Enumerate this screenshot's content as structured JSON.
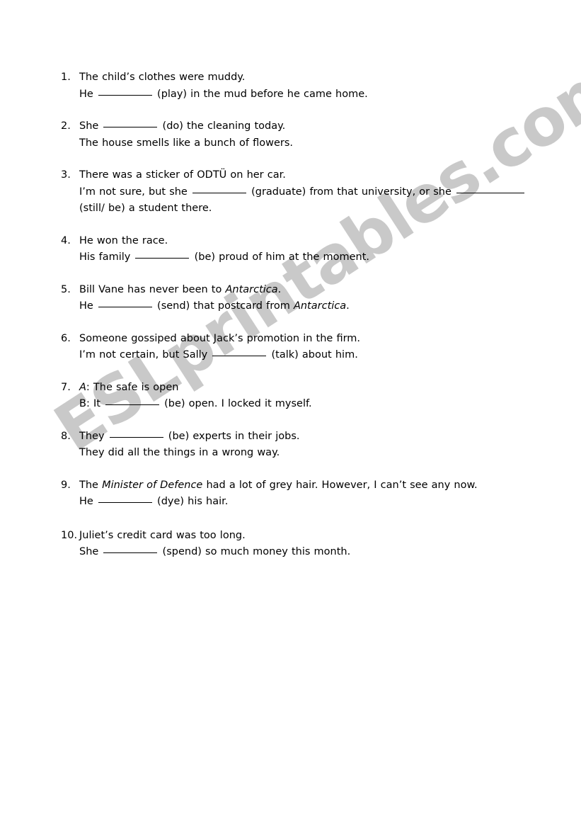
{
  "watermark": {
    "text": "ESLprintables.com",
    "color": "#c9c9c9"
  },
  "worksheet": {
    "items": [
      {
        "number": "1.",
        "lines": [
          {
            "segments": [
              {
                "text": "The child’s clothes were muddy."
              }
            ]
          },
          {
            "segments": [
              {
                "text": "He "
              },
              {
                "blank": "std"
              },
              {
                "text": " (play) in the mud before he came home."
              }
            ]
          }
        ]
      },
      {
        "number": "2.",
        "lines": [
          {
            "segments": [
              {
                "text": "She "
              },
              {
                "blank": "std"
              },
              {
                "text": " (do) the cleaning today."
              }
            ]
          },
          {
            "segments": [
              {
                "text": "The house smells like a bunch of flowers."
              }
            ]
          }
        ]
      },
      {
        "number": "3.",
        "lines": [
          {
            "segments": [
              {
                "text": "There was a sticker of ODTÜ on her car."
              }
            ]
          },
          {
            "segments": [
              {
                "text": "I’m not sure, but she "
              },
              {
                "blank": "std"
              },
              {
                "text": " (graduate) from that university, or she "
              },
              {
                "blank": "long"
              }
            ]
          },
          {
            "segments": [
              {
                "text": "(still/ be) a student there."
              }
            ]
          }
        ]
      },
      {
        "number": "4.",
        "lines": [
          {
            "segments": [
              {
                "text": "He won the race."
              }
            ]
          },
          {
            "segments": [
              {
                "text": "His family "
              },
              {
                "blank": "std"
              },
              {
                "text": " (be) proud of him at the moment."
              }
            ]
          }
        ]
      },
      {
        "number": "5.",
        "lines": [
          {
            "segments": [
              {
                "text": "Bill Vane has never been to "
              },
              {
                "text": "Antarctica",
                "italic": true
              },
              {
                "text": "."
              }
            ]
          },
          {
            "segments": [
              {
                "text": "He "
              },
              {
                "blank": "std"
              },
              {
                "text": " (send) that postcard from "
              },
              {
                "text": "Antarctica",
                "italic": true
              },
              {
                "text": "."
              }
            ]
          }
        ]
      },
      {
        "number": "6.",
        "lines": [
          {
            "segments": [
              {
                "text": "Someone gossiped about Jack’s promotion in the firm."
              }
            ]
          },
          {
            "segments": [
              {
                "text": "I’m not certain, but Sally "
              },
              {
                "blank": "std"
              },
              {
                "text": " (talk) about him."
              }
            ]
          }
        ]
      },
      {
        "number": "7.",
        "lines": [
          {
            "segments": [
              {
                "text": "A",
                "italic": true
              },
              {
                "text": ": The safe is open"
              }
            ]
          },
          {
            "segments": [
              {
                "text": "B: It "
              },
              {
                "blank": "std"
              },
              {
                "text": " (be) open. I locked it myself."
              }
            ]
          }
        ]
      },
      {
        "number": "8.",
        "lines": [
          {
            "segments": [
              {
                "text": "They "
              },
              {
                "blank": "std"
              },
              {
                "text": " (be) experts in their jobs."
              }
            ]
          },
          {
            "segments": [
              {
                "text": "They did all the things in a wrong way."
              }
            ]
          }
        ]
      },
      {
        "number": "9.",
        "lines": [
          {
            "segments": [
              {
                "text": "The "
              },
              {
                "text": "Minister of Defence",
                "italic": true
              },
              {
                "text": " had a lot of grey hair. However, I can’t see any now."
              }
            ]
          },
          {
            "segments": [
              {
                "text": "He "
              },
              {
                "blank": "std"
              },
              {
                "text": " (dye) his hair."
              }
            ]
          }
        ]
      },
      {
        "number": "10.",
        "extra_gap": true,
        "lines": [
          {
            "segments": [
              {
                "text": "Juliet’s credit card was too long."
              }
            ]
          },
          {
            "segments": [
              {
                "text": "She "
              },
              {
                "blank": "std"
              },
              {
                "text": " (spend) so much money this month."
              }
            ]
          }
        ]
      }
    ]
  }
}
